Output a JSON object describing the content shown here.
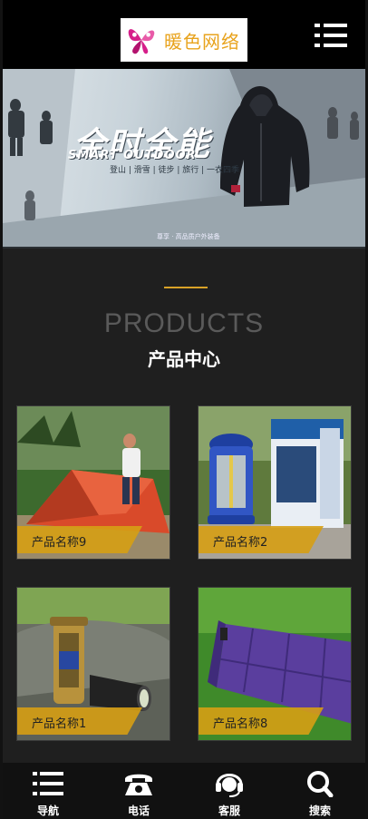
{
  "header": {
    "logo_text": "暖色网络",
    "menu_icon": "menu-icon"
  },
  "banner": {
    "title": "全时全能",
    "subtitle": "SMART OUTDOOR",
    "tags": "登山 | 滑雪 | 徒步 | 旅行 | 一衣四季",
    "caption": "尊享 · 高品质户外装备"
  },
  "products_section": {
    "heading_en": "PRODUCTS",
    "heading_cn": "产品中心",
    "accent_color": "#d8a227",
    "items": [
      {
        "name": "产品名称9",
        "image": "tent-photo"
      },
      {
        "name": "产品名称2",
        "image": "lantern-box-photo"
      },
      {
        "name": "产品名称1",
        "image": "flashlight-photo"
      },
      {
        "name": "产品名称8",
        "image": "sleeping-mat-photo"
      }
    ]
  },
  "bottom_nav": [
    {
      "label": "导航",
      "icon": "list-icon"
    },
    {
      "label": "电话",
      "icon": "phone-icon"
    },
    {
      "label": "客服",
      "icon": "headset-icon"
    },
    {
      "label": "搜索",
      "icon": "search-icon"
    }
  ]
}
